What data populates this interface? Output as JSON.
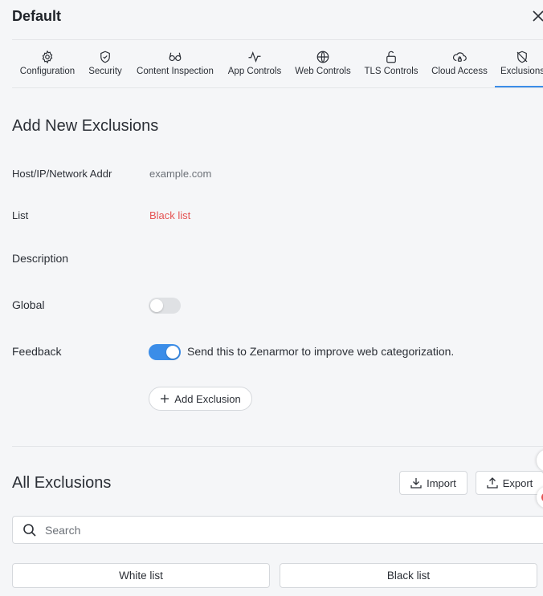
{
  "header": {
    "title": "Default"
  },
  "tabs": [
    {
      "label": "Configuration",
      "icon": "gear-icon"
    },
    {
      "label": "Security",
      "icon": "shield-check-icon"
    },
    {
      "label": "Content Inspection",
      "icon": "glasses-icon"
    },
    {
      "label": "App Controls",
      "icon": "activity-icon"
    },
    {
      "label": "Web Controls",
      "icon": "globe-icon"
    },
    {
      "label": "TLS Controls",
      "icon": "unlock-icon"
    },
    {
      "label": "Cloud Access",
      "icon": "cloud-lock-icon"
    },
    {
      "label": "Exclusions",
      "icon": "shield-off-icon",
      "active": true
    }
  ],
  "add_form": {
    "title": "Add New Exclusions",
    "host_label": "Host/IP/Network Addr",
    "host_placeholder": "example.com",
    "list_label": "List",
    "list_value": "Black list",
    "description_label": "Description",
    "global_label": "Global",
    "global_on": false,
    "feedback_label": "Feedback",
    "feedback_on": true,
    "feedback_text": "Send this to Zenarmor to improve web categorization.",
    "add_button": "Add Exclusion"
  },
  "all_exclusions": {
    "title": "All Exclusions",
    "import_label": "Import",
    "export_label": "Export",
    "search_placeholder": "Search",
    "white_list_label": "White list",
    "black_list_label": "Black list"
  },
  "colors": {
    "accent": "#3b8de8",
    "danger": "#e55353",
    "muted": "#6b7077"
  }
}
